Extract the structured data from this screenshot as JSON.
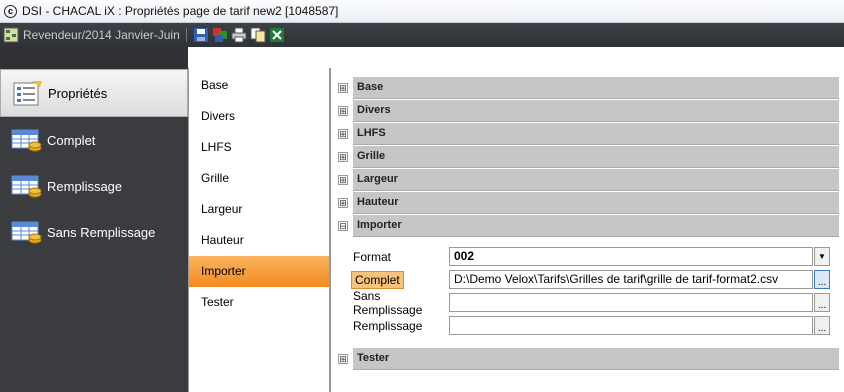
{
  "window": {
    "title": "DSI - CHACAL iX : Propriétés page de tarif new2 [1048587]",
    "icon": "chacal-logo-icon"
  },
  "toolbar": {
    "path": "Revendeur/2014 Janvier-Juin"
  },
  "nav": {
    "items": [
      {
        "label": "Propriétés",
        "active": true
      },
      {
        "label": "Complet"
      },
      {
        "label": "Remplissage"
      },
      {
        "label": "Sans Remplissage"
      }
    ]
  },
  "sections": {
    "items": [
      {
        "label": "Base"
      },
      {
        "label": "Divers"
      },
      {
        "label": "LHFS"
      },
      {
        "label": "Grille"
      },
      {
        "label": "Largeur"
      },
      {
        "label": "Hauteur"
      },
      {
        "label": "Importer",
        "active": true
      },
      {
        "label": "Tester"
      }
    ]
  },
  "grid": {
    "categories": [
      "Base",
      "Divers",
      "LHFS",
      "Grille",
      "Largeur",
      "Hauteur",
      "Importer",
      "Tester"
    ],
    "importer": {
      "format": {
        "label": "Format",
        "value": "002"
      },
      "complet": {
        "label": "Complet",
        "value": "D:\\Demo Velox\\Tarifs\\Grilles de tarif\\grille de tarif-format2.csv"
      },
      "sans_remplissage": {
        "label": "Sans Remplissage",
        "value": ""
      },
      "remplissage": {
        "label": "Remplissage",
        "value": ""
      }
    },
    "collapsed_symbol": "⊞",
    "expanded_symbol": "⊟",
    "ellipsis": "...",
    "dropdown": "▼"
  },
  "colors": {
    "accent": "#f28a1f",
    "nav_bg": "#3a3c40",
    "category_bg": "#c6c6c6"
  }
}
